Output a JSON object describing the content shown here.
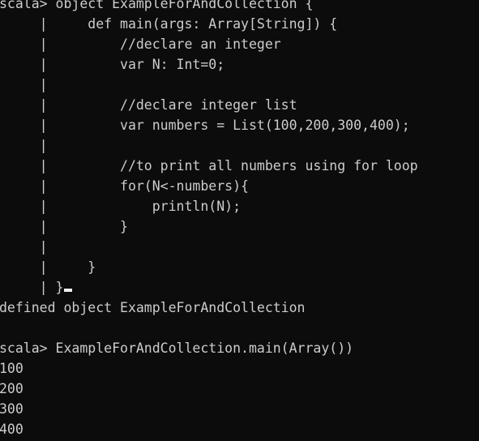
{
  "terminal": {
    "lines": [
      "scala> object ExampleForAndCollection {",
      "     |     def main(args: Array[String]) {",
      "     |         //declare an integer",
      "     |         var N: Int=0;",
      "     |",
      "     |         //declare integer list",
      "     |         var numbers = List(100,200,300,400);",
      "     |",
      "     |         //to print all numbers using for loop",
      "     |         for(N<-numbers){",
      "     |             println(N);",
      "     |         }",
      "     |",
      "     |     }",
      "     | }",
      "defined object ExampleForAndCollection",
      "",
      "scala> ExampleForAndCollection.main(Array())",
      "100",
      "200",
      "300",
      "400"
    ]
  }
}
